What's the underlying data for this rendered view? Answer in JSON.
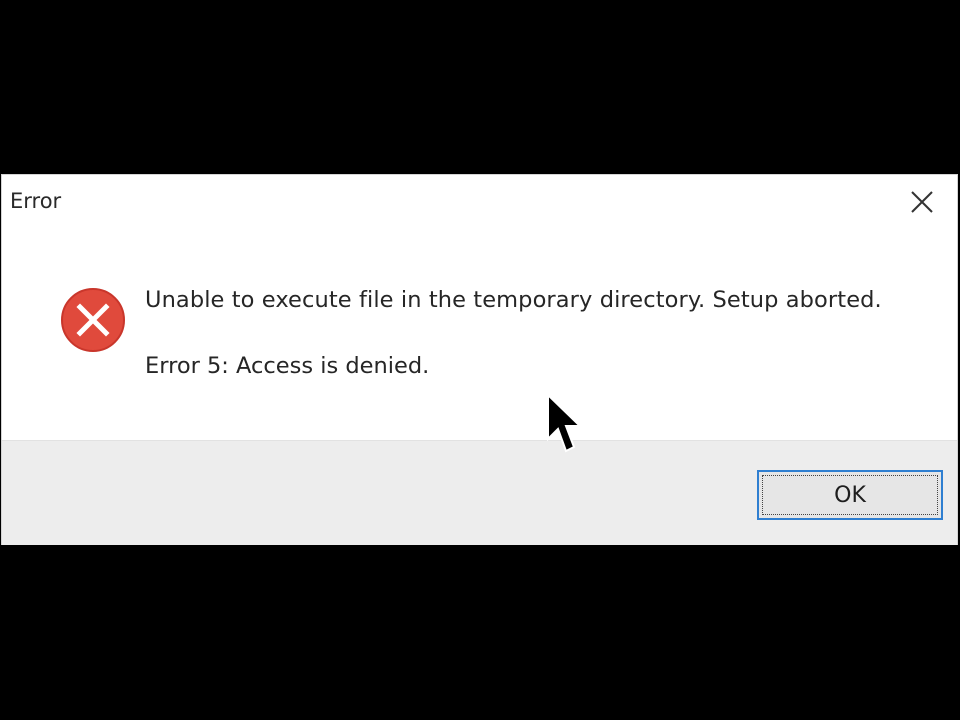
{
  "dialog": {
    "title": "Error",
    "close_icon": "close-icon",
    "message": "Unable to execute file in the temporary directory. Setup aborted.",
    "detail": "Error 5: Access is denied.",
    "icon": "error-icon",
    "ok_label": "OK"
  },
  "colors": {
    "background": "#000000",
    "dialog_bg": "#ffffff",
    "footer_bg": "#ededed",
    "error_red": "#e04a3c",
    "button_border": "#2f7fd1"
  },
  "cursor": {
    "icon": "mouse-pointer-icon"
  }
}
